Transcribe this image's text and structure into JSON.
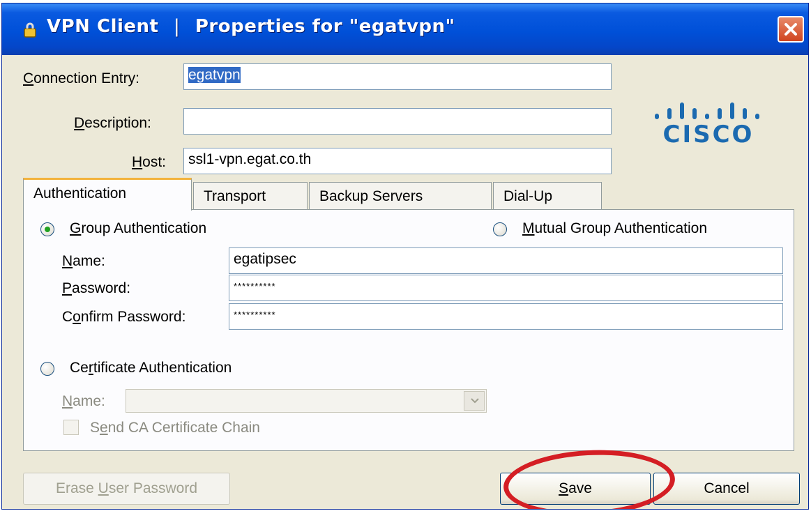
{
  "titlebar": {
    "app": "VPN Client",
    "separator": "|",
    "title": "Properties for \"egatvpn\""
  },
  "form": {
    "connection_entry": {
      "label_key": "C",
      "label_rest": "onnection Entry:",
      "value": "egatvpn"
    },
    "description": {
      "label_key": "D",
      "label_rest": "escription:",
      "value": ""
    },
    "host": {
      "label_key": "H",
      "label_rest": "ost:",
      "value": "ssl1-vpn.egat.co.th"
    }
  },
  "logo": {
    "text": "cisco"
  },
  "tabs": [
    {
      "label": "Authentication",
      "active": true
    },
    {
      "label": "Transport",
      "active": false
    },
    {
      "label": "Backup Servers",
      "active": false
    },
    {
      "label": "Dial-Up",
      "active": false
    }
  ],
  "auth": {
    "group_auth": {
      "key": "G",
      "rest": "roup Authentication",
      "selected": true
    },
    "mutual_auth": {
      "key": "M",
      "rest": "utual Group Authentication",
      "selected": false
    },
    "name": {
      "label_key": "N",
      "label_rest": "ame:",
      "value": "egatipsec"
    },
    "password": {
      "label_key": "P",
      "label_rest": "assword:",
      "value": "**********"
    },
    "confirm_password": {
      "label_pre": "C",
      "label_key": "o",
      "label_rest": "nfirm Password:",
      "value": "**********"
    },
    "cert_auth": {
      "label_pre": "Ce",
      "label_key": "r",
      "label_rest": "tificate Authentication",
      "selected": false
    },
    "cert_name": {
      "label_key": "N",
      "label_rest": "ame:",
      "value": ""
    },
    "send_ca": {
      "label_pre": "S",
      "label_key": "e",
      "label_rest": "nd CA Certificate Chain",
      "checked": false
    }
  },
  "buttons": {
    "erase": {
      "pre": "Erase ",
      "key": "U",
      "rest": "ser Password"
    },
    "save": {
      "key": "S",
      "rest": "ave"
    },
    "cancel": {
      "label": "Cancel"
    }
  },
  "colors": {
    "titlebar": "#0050d8",
    "annotation": "#d41e24",
    "logo": "#1b6ab0",
    "tab_highlight": "#f3b33d"
  }
}
